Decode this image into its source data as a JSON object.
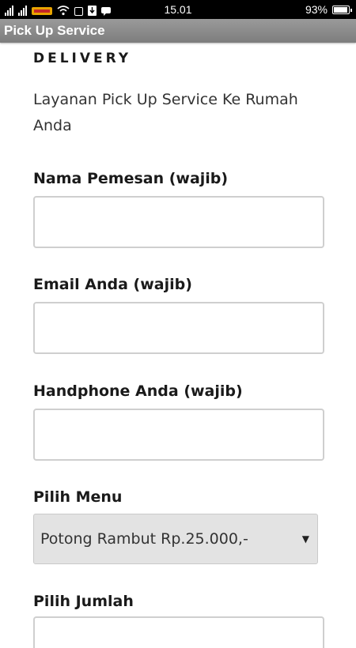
{
  "status_bar": {
    "time": "15.01",
    "battery": "93%",
    "battery_level": 0.93,
    "icons": [
      "signal-icon",
      "signal-icon",
      "carrier-icon",
      "wifi-icon",
      "notification-icon",
      "download-icon",
      "chat-icon",
      "battery-icon"
    ]
  },
  "app": {
    "title": "Pick Up Service"
  },
  "page": {
    "heading": "DELIVERY",
    "intro": "Layanan Pick Up Service Ke Rumah Anda"
  },
  "form": {
    "name_label": "Nama Pemesan (wajib)",
    "email_label": "Email Anda (wajib)",
    "phone_label": "Handphone Anda (wajib)",
    "menu_label": "Pilih Menu",
    "menu_selected": "Potong Rambut Rp.25.000,-",
    "quantity_label": "Pilih Jumlah"
  }
}
